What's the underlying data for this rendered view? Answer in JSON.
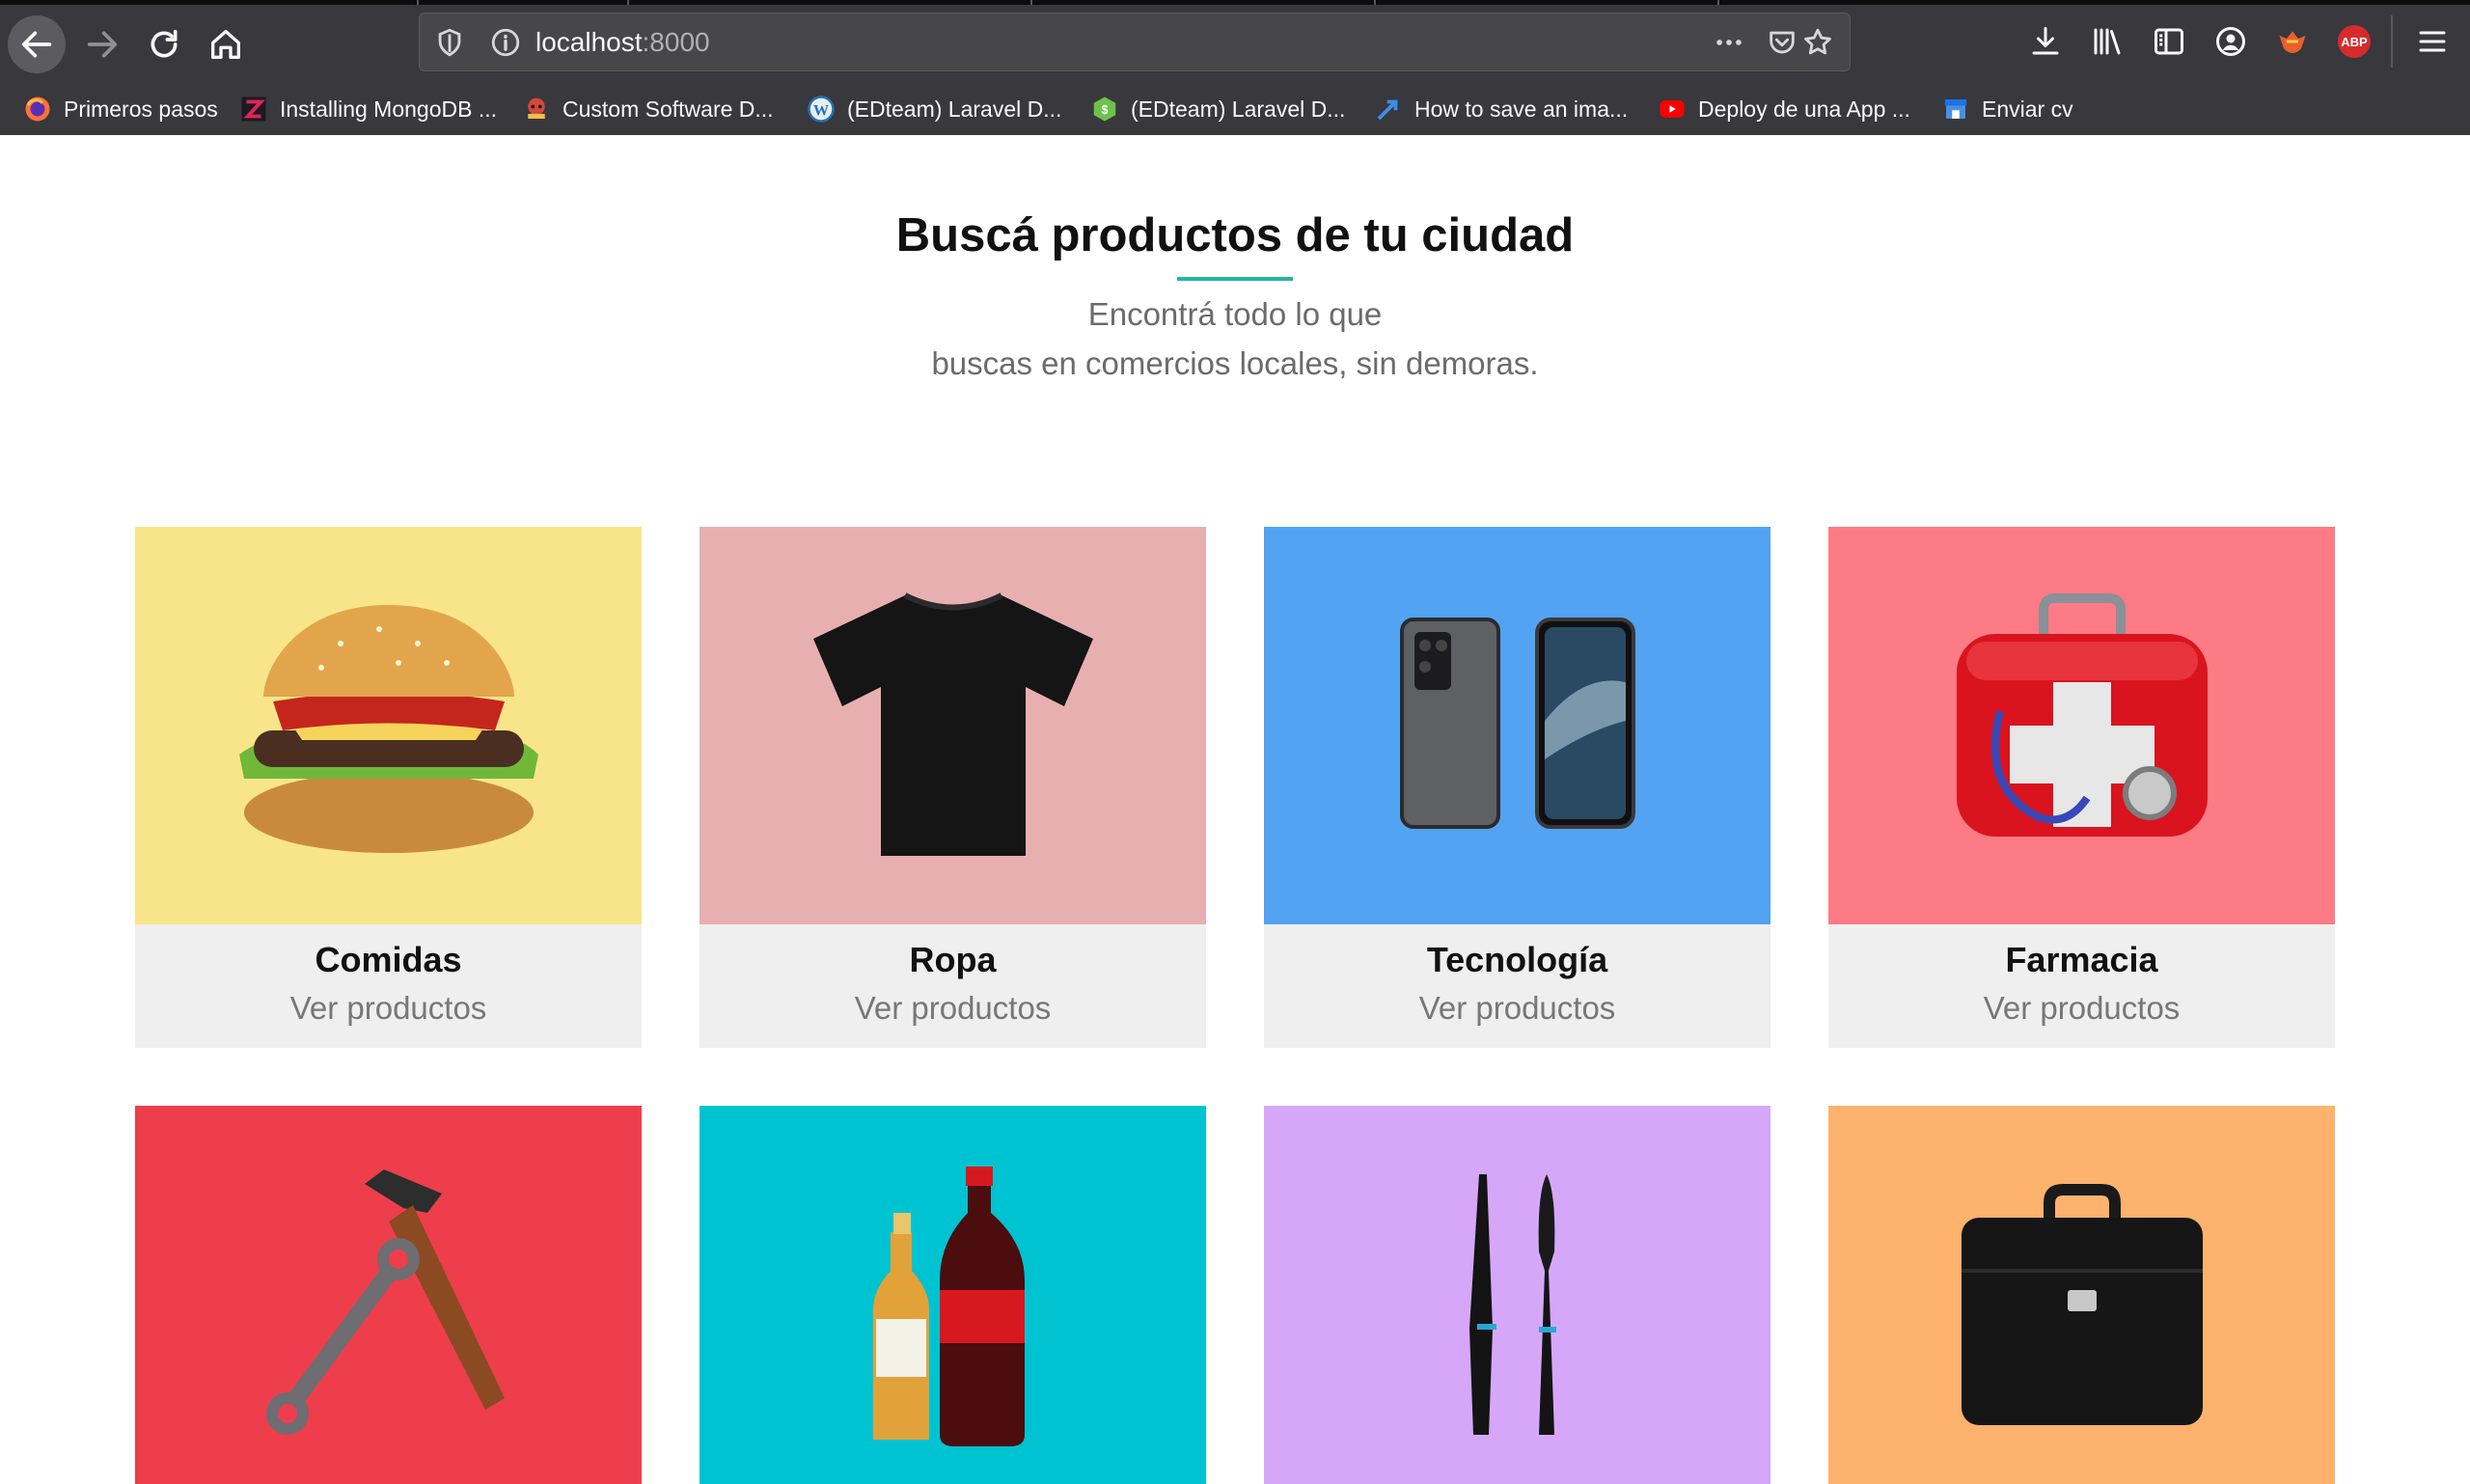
{
  "browser": {
    "url_host": "localhost",
    "url_port": ":8000",
    "abp_label": "ABP",
    "bookmarks": [
      {
        "label": "Primeros pasos",
        "icon": "firefox-icon"
      },
      {
        "label": "Installing MongoDB ...",
        "icon": "zeal-logo-icon"
      },
      {
        "label": "Custom Software D...",
        "icon": "company-logo-icon"
      },
      {
        "label": "(EDteam) Laravel D...",
        "icon": "wordpress-icon"
      },
      {
        "label": "(EDteam) Laravel D...",
        "icon": "hexagon-logo-icon"
      },
      {
        "label": "How to save an ima...",
        "icon": "arrow-logo-icon"
      },
      {
        "label": "Deploy de una App ...",
        "icon": "youtube-icon"
      },
      {
        "label": "Enviar cv",
        "icon": "store-icon"
      }
    ]
  },
  "page": {
    "title": "Buscá productos de tu ciudad",
    "subtitle_line1": "Encontrá todo lo que",
    "subtitle_line2": "buscas en comercios locales, sin demoras.",
    "accent_color": "#27b3a6"
  },
  "categories": [
    {
      "name": "Comidas",
      "link": "Ver productos",
      "bg": "#f9e589",
      "icon": "burger-icon"
    },
    {
      "name": "Ropa",
      "link": "Ver productos",
      "bg": "#e8afb1",
      "icon": "tshirt-icon"
    },
    {
      "name": "Tecnología",
      "link": "Ver productos",
      "bg": "#52a3f2",
      "icon": "smartphones-icon"
    },
    {
      "name": "Farmacia",
      "link": "Ver productos",
      "bg": "#fd7b85",
      "icon": "first-aid-kit-icon"
    },
    {
      "name": "",
      "link": "",
      "bg": "#ee3e4b",
      "icon": "tools-icon"
    },
    {
      "name": "",
      "link": "",
      "bg": "#00c3d1",
      "icon": "drinks-icon"
    },
    {
      "name": "",
      "link": "",
      "bg": "#d6a7f9",
      "icon": "mascara-icon"
    },
    {
      "name": "",
      "link": "",
      "bg": "#fdb26d",
      "icon": "briefcase-icon"
    }
  ]
}
